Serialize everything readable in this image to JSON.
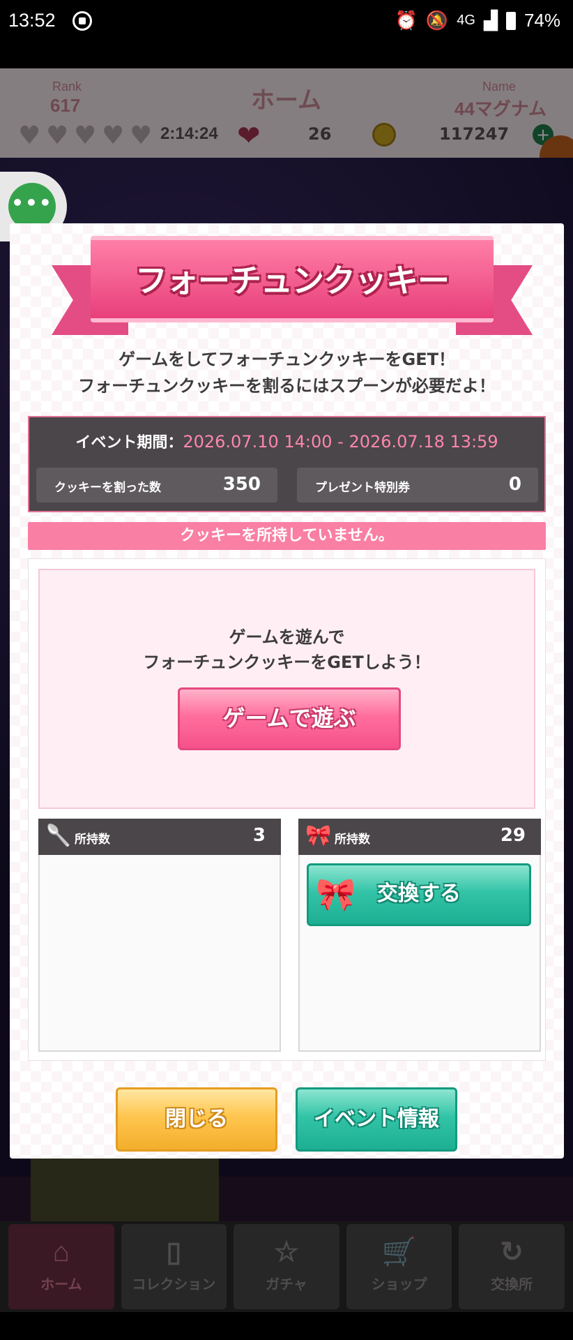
{
  "status_bar": {
    "time": "13:52",
    "network": "4G",
    "battery": "74%",
    "icons": [
      "screen-record-icon",
      "alarm-icon",
      "bell-off-icon",
      "signal-icon",
      "battery-icon"
    ]
  },
  "app_header": {
    "rank_label": "Rank",
    "rank_value": "617",
    "title": "ホーム",
    "name_label": "Name",
    "name_value": "44マグナム",
    "timer": "2:14:24",
    "heart_count": "26",
    "coin_count": "117247"
  },
  "modal": {
    "title": "フォーチュンクッキー",
    "description_line1": "ゲームをしてフォーチュンクッキーをGET！",
    "description_line2": "フォーチュンクッキーを割るにはスプーンが必要だよ！",
    "period_label": "イベント期間：",
    "period_range": "2026.07.10 14:00 - 2026.07.18 13:59",
    "stat_cookies_label": "クッキーを割った数",
    "stat_cookies_value": "350",
    "stat_tickets_label": "プレゼント特別券",
    "stat_tickets_value": "0",
    "notice": "クッキーを所持していません。",
    "play_text_line1": "ゲームを遊んで",
    "play_text_line2": "フォーチュンクッキーをGETしよう！",
    "play_button": "ゲームで遊ぶ",
    "spoon_panel": {
      "label": "所持数",
      "value": "3"
    },
    "golden_spoon_panel": {
      "label": "所持数",
      "value": "29"
    },
    "exchange_button": "交換する",
    "close_button": "閉じる",
    "event_info_button": "イベント情報"
  },
  "bottom_nav": {
    "items": [
      {
        "label": "ホーム",
        "icon": "home-icon"
      },
      {
        "label": "コレクション",
        "icon": "book-icon"
      },
      {
        "label": "ガチャ",
        "icon": "card-star-icon"
      },
      {
        "label": "ショップ",
        "icon": "cart-icon"
      },
      {
        "label": "交換所",
        "icon": "exchange-coin-icon"
      }
    ]
  },
  "colors": {
    "accent_pink": "#fa7fa5",
    "teal": "#1daf92",
    "orange": "#ffc64f",
    "dark_panel": "#4a4649"
  }
}
